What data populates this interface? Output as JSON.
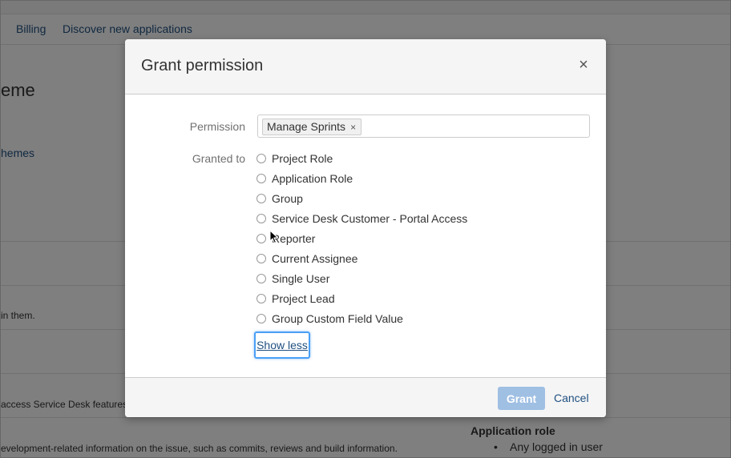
{
  "background": {
    "nav_links": [
      "Billing",
      "Discover new applications"
    ],
    "heading": "eme",
    "schemes_link": "hemes",
    "text_1": "in them.",
    "text_2": "access Service Desk features",
    "text_3": "evelopment-related information on the issue, such as commits, reviews and build information.",
    "application_role_title": "Application role",
    "application_role_items": [
      "Any logged in user"
    ]
  },
  "dialog": {
    "title": "Grant permission",
    "close_glyph": "×",
    "permission_label": "Permission",
    "permission_value": "Manage Sprints",
    "permission_remove_glyph": "×",
    "granted_to_label": "Granted to",
    "options": [
      "Project Role",
      "Application Role",
      "Group",
      "Service Desk Customer - Portal Access",
      "Reporter",
      "Current Assignee",
      "Single User",
      "Project Lead",
      "Group Custom Field Value"
    ],
    "show_less_label": "Show less",
    "grant_label": "Grant",
    "cancel_label": "Cancel"
  },
  "colors": {
    "link": "#205081",
    "grant_disabled": "#9fbfe3",
    "focus_ring": "#4a9ff5"
  }
}
